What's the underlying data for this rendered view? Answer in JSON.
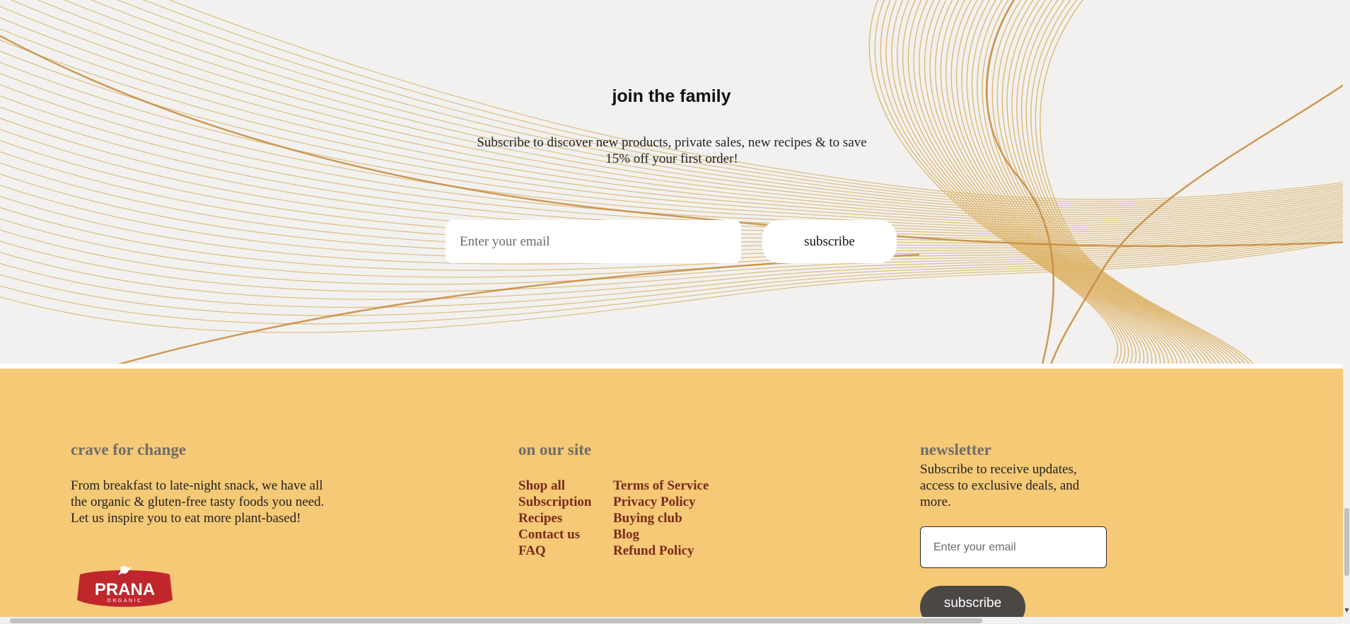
{
  "join": {
    "title": "join the family",
    "subtitle": "Subscribe to discover new products, private sales, new recipes & to save 15% off your first order!",
    "email_placeholder": "Enter your email",
    "subscribe_label": "subscribe"
  },
  "footer": {
    "about": {
      "heading": "crave for change",
      "text": "From breakfast to late-night snack, we have all the organic & gluten-free tasty foods you need. Let us inspire you to eat more plant-based!"
    },
    "site": {
      "heading": "on our site",
      "col1": [
        "Shop all",
        "Subscription",
        "Recipes",
        "Contact us",
        "FAQ"
      ],
      "col2": [
        "Terms of Service",
        "Privacy Policy",
        "Buying club",
        "Blog",
        "Refund Policy"
      ]
    },
    "newsletter": {
      "heading": "newsletter",
      "text": "Subscribe to receive updates, access to exclusive deals, and more.",
      "email_placeholder": "Enter your email",
      "subscribe_label": "subscribe"
    },
    "logo": {
      "brand": "PRANA",
      "tagline": "ORGANIC"
    }
  },
  "colors": {
    "footer_bg": "#f5c975",
    "link": "#7a2a1f",
    "heading_gray": "#6e6d6a",
    "nl_button": "#4a4745",
    "logo_red": "#c0272d",
    "gold": "#d4a04a"
  },
  "icons": [
    "prana-hummingbird-logo",
    "scroll-down-arrow-icon"
  ]
}
